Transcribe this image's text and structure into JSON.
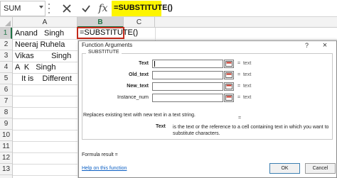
{
  "formula_bar": {
    "name_box": "SUM",
    "cancel_icon": "cancel-x-icon",
    "enter_icon": "enter-check-icon",
    "fx_label": "fx",
    "formula": "=SUBSTITUTE()",
    "highlight_color": "#fdf500"
  },
  "grid": {
    "columns": [
      "A",
      "B",
      "C"
    ],
    "rows": [
      "1",
      "2",
      "3",
      "4",
      "5",
      "6",
      "7",
      "8",
      "9",
      "10",
      "11",
      "12",
      "13"
    ],
    "active_row": "1",
    "active_column": "B",
    "active_cell_value": "=SUBSTITUTE()",
    "column_a": [
      "Anand   Singh",
      "Neeraj Ruhela",
      "Vikas        Singh",
      "A  K   Singh",
      "   It is    Different"
    ]
  },
  "dialog": {
    "title": "Function Arguments",
    "help_label": "?",
    "close_label": "×",
    "function_name": "SUBSTITUTE",
    "arguments": [
      {
        "label": "Text",
        "result": "=  text"
      },
      {
        "label": "Old_text",
        "result": "=  text"
      },
      {
        "label": "New_text",
        "result": "=  text"
      },
      {
        "label": "Instance_num",
        "result": "=  text"
      }
    ],
    "result_equals": "=",
    "description": "Replaces existing text with new text in a text string.",
    "selected_argument": "Text",
    "selected_argument_description": "is the text or the reference to a cell containing text in which you want to substitute characters.",
    "formula_result": "Formula result =",
    "help_link": "Help on this function",
    "ok_label": "OK",
    "cancel_label": "Cancel"
  },
  "colors": {
    "active_cell_border": "#c42b1c",
    "header_accent": "#217346",
    "link": "#0b5fc4"
  }
}
